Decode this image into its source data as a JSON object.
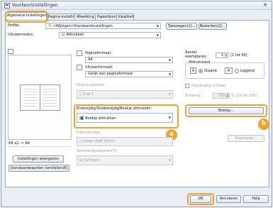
{
  "window": {
    "title": "Voorkeursinstellingen",
    "close_glyph": "✕"
  },
  "tabs": [
    {
      "label": "Algemene instellingen"
    },
    {
      "label": "Pagina-instelling"
    },
    {
      "label": "Afwerking"
    },
    {
      "label": "Papierbron"
    },
    {
      "label": "Kwaliteit"
    }
  ],
  "profile": {
    "label": "Profiel:",
    "value": "<Wijzigen>Standaardinstellingen",
    "add_button": "Toevoegen(1)...",
    "edit_button": "Bewerken(2)..."
  },
  "output": {
    "label": "Uitvoermodus:",
    "value": "Afdrukken"
  },
  "preview": {
    "caption": "A4 x2 -> A4"
  },
  "page_format": {
    "label": "Paginaformaat:",
    "value": "A4"
  },
  "output_format": {
    "label": "Uitvoerformaat:",
    "value": "Gelijk aan paginaformaat"
  },
  "page_layout": {
    "label": "Pagina-opmaak:",
    "value": "1 op 1"
  },
  "copies": {
    "label_line1": "Aantal",
    "label_line2": "exemplaren:",
    "value": "1",
    "range": "[1 tot 99]"
  },
  "orientation": {
    "label": "Afdrukstand",
    "portrait_icon": "A",
    "portrait": "Staand",
    "landscape_icon": "A",
    "landscape": "Liggend",
    "selected": "Staand"
  },
  "manual_scaling": {
    "label": "Handmatig schalen",
    "scale_label": "Schaling:",
    "scale_value": "100",
    "scale_range": "% [25 tot 200]"
  },
  "duplex": {
    "label": "Enkelzijdig/Dubbelzijdig/Boekje afdrukken:",
    "value": "Boekje afdrukken",
    "booklet_button": "Boekje..."
  },
  "binding": {
    "label": "Inbindlocatie:",
    "value": "Lange zijde [links]",
    "gutter_button": "Rugmarge..."
  },
  "sorting": {
    "label": "Sorteren/groeperen(7):",
    "value": "Sorteren"
  },
  "left_buttons": {
    "view_settings": "Instellingen weergeven",
    "restore_defaults": "Standaardwaarden herstellen(6)"
  },
  "footer": {
    "ok": "OK",
    "cancel": "Annuleren",
    "help": "Help"
  },
  "callouts": {
    "a": "a",
    "b": "b"
  },
  "colors": {
    "accent": "#f2a22a",
    "selection": "#3a6db5"
  }
}
